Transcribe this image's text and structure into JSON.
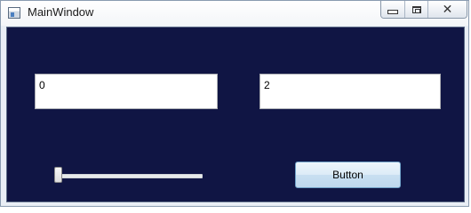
{
  "window": {
    "title": "MainWindow",
    "icon": "app-window-icon",
    "controls": [
      "minimize-icon",
      "maximize-icon",
      "close-icon"
    ]
  },
  "main": {
    "textbox_left": {
      "value": "0"
    },
    "textbox_right": {
      "value": "2"
    },
    "slider": {
      "value": 0,
      "min": 0,
      "max": 10
    },
    "button": {
      "label": "Button"
    }
  },
  "colors": {
    "client_background": "#101544",
    "button_border": "#6fa0c7"
  }
}
